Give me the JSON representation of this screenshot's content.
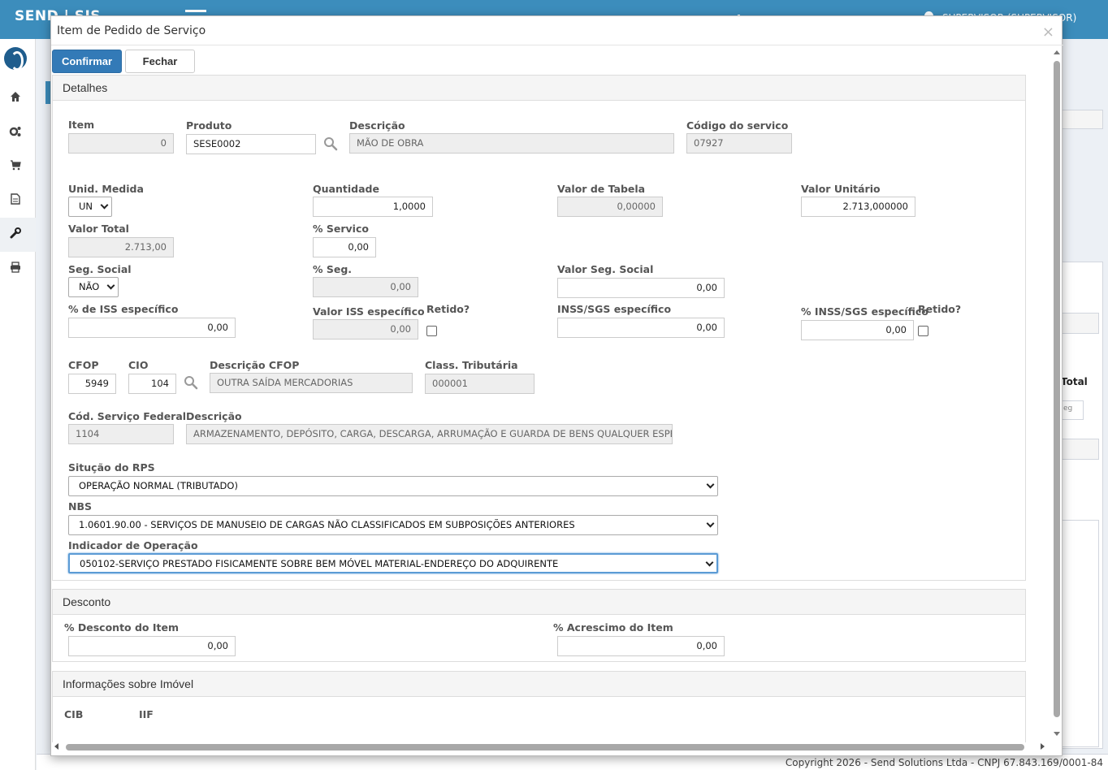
{
  "app": {
    "brand": "SEND | SIS",
    "user": "SUPERVISOR (SUPERVISOR)",
    "footer": "Copyright 2026 - Send Solutions Ltda - CNPJ 67.843.169/0001-84",
    "bg_total_label": "Total",
    "bg_cell": "eg"
  },
  "sidebar": {
    "items": [
      {
        "icon": "home-icon",
        "glyph": "⌂"
      },
      {
        "icon": "gears-icon",
        "glyph": "⚙"
      },
      {
        "icon": "cart-icon",
        "glyph": "🛒"
      },
      {
        "icon": "document-icon",
        "glyph": "▤"
      },
      {
        "icon": "wrench-icon",
        "glyph": "🔧"
      },
      {
        "icon": "print-icon",
        "glyph": "⎙"
      }
    ]
  },
  "modal": {
    "title": "Item de Pedido de Serviço",
    "close": "×",
    "confirm_label": "Confirmar",
    "close_label": "Fechar"
  },
  "detalhes": {
    "title": "Detalhes",
    "item_label": "Item",
    "item_value": "0",
    "produto_label": "Produto",
    "produto_value": "SESE0002",
    "descricao_label": "Descrição",
    "descricao_value": "MÃO DE OBRA",
    "codigo_servico_label": "Código do servico",
    "codigo_servico_value": "07927",
    "unid_medida_label": "Unid. Medida",
    "unid_medida_value": "UN",
    "quantidade_label": "Quantidade",
    "quantidade_value": "1,0000",
    "valor_tabela_label": "Valor de Tabela",
    "valor_tabela_value": "0,00000",
    "valor_unitario_label": "Valor Unitário",
    "valor_unitario_value": "2.713,000000",
    "valor_total_label": "Valor Total",
    "valor_total_value": "2.713,00",
    "pct_servico_label": "% Servico",
    "pct_servico_value": "0,00",
    "seg_social_label": "Seg. Social",
    "seg_social_value": "NÃO",
    "pct_seg_label": "% Seg.",
    "pct_seg_value": "0,00",
    "valor_seg_social_label": "Valor Seg. Social",
    "valor_seg_social_value": "0,00",
    "pct_iss_label": "% de ISS específico",
    "pct_iss_value": "0,00",
    "valor_iss_label": "Valor ISS específico",
    "valor_iss_value": "0,00",
    "retido_label": "Retido?",
    "inss_label": "INSS/SGS específico",
    "inss_value": "0,00",
    "pct_inss_label": "% INSS/SGS específico",
    "pct_inss_value": "0,00",
    "retido2_label": "Retido?",
    "cfop_label": "CFOP",
    "cfop_value": "5949",
    "cio_label": "CIO",
    "cio_value": "104",
    "desc_cfop_label": "Descrição CFOP",
    "desc_cfop_value": "OUTRA SAÍDA MERCADORIAS",
    "class_trib_label": "Class. Tributária",
    "class_trib_value": "000001",
    "cod_serv_fed_label": "Cód. Serviço Federal",
    "cod_serv_fed_value": "1104",
    "desc_fed_label": "Descrição",
    "desc_fed_value": "ARMAZENAMENTO, DEPÓSITO, CARGA, DESCARGA, ARRUMAÇÃO E GUARDA DE BENS QUALQUER ESPÉCIE.",
    "situacao_rps_label": "Situção do RPS",
    "situacao_rps_value": "OPERAÇÃO NORMAL (TRIBUTADO)",
    "nbs_label": "NBS",
    "nbs_value": "1.0601.90.00 - SERVIÇOS DE MANUSEIO DE CARGAS NÃO CLASSIFICADOS EM SUBPOSIÇÕES ANTERIORES",
    "indicador_label": "Indicador de Operação",
    "indicador_value": "050102-SERVIÇO PRESTADO FISICAMENTE SOBRE BEM MÓVEL MATERIAL-ENDEREÇO DO ADQUIRENTE"
  },
  "desconto": {
    "title": "Desconto",
    "pct_desconto_label": "% Desconto do Item",
    "pct_desconto_value": "0,00",
    "pct_acrescimo_label": "% Acrescimo do Item",
    "pct_acrescimo_value": "0,00"
  },
  "imovel": {
    "title": "Informações sobre Imóvel",
    "cib_label": "CIB",
    "iif_label": "IIF"
  }
}
